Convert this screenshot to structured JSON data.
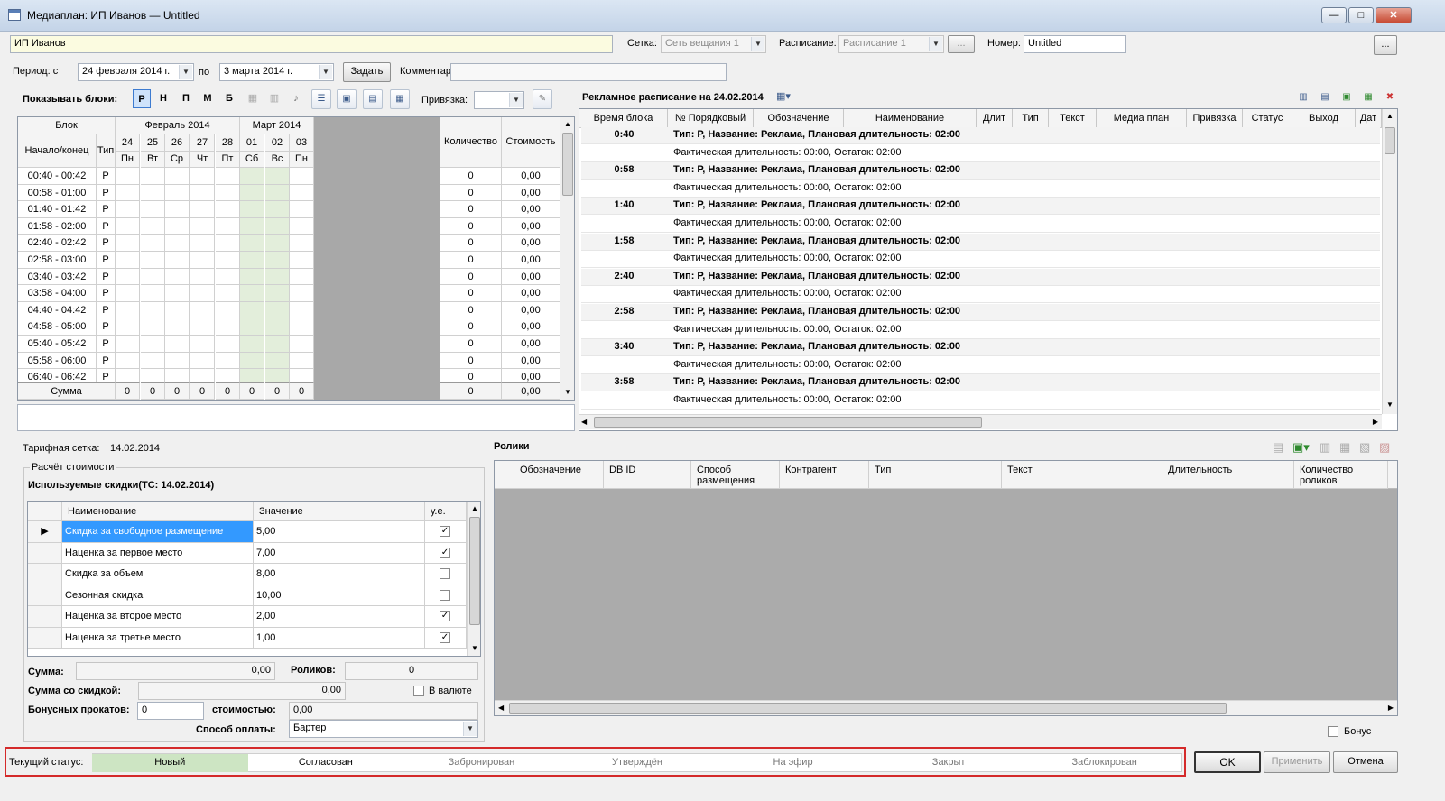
{
  "window": {
    "title": "Медиаплан: ИП Иванов — Untitled",
    "min": "—",
    "max": "□",
    "close": "✕"
  },
  "top": {
    "client": "ИП Иванов",
    "network_label": "Сетка:",
    "network_value": "Сеть вещания 1",
    "schedule_label": "Расписание:",
    "schedule_value": "Расписание 1",
    "ellipsis": "...",
    "number_label": "Номер:",
    "number_value": "Untitled",
    "period_label": "Период: с",
    "period_from": "24 февраля  2014 г.",
    "period_to_label": "по",
    "period_to": "3   марта   2014 г.",
    "set_button": "Задать",
    "comment_label": "Комментарий:",
    "comment_value": ""
  },
  "blocks_toolbar": {
    "label": "Показывать блоки:",
    "buttons": [
      "Р",
      "Н",
      "П",
      "М",
      "Б"
    ],
    "anchor_label": "Привязка:",
    "anchor_value": ""
  },
  "block_grid": {
    "col_block": "Блок",
    "col_startend": "Начало/конец",
    "col_type": "Тип",
    "month1": "Февраль 2014",
    "month2": "Март 2014",
    "days": [
      "24",
      "25",
      "26",
      "27",
      "28",
      "01",
      "02",
      "03"
    ],
    "weekdays": [
      "Пн",
      "Вт",
      "Ср",
      "Чт",
      "Пт",
      "Сб",
      "Вс",
      "Пн"
    ],
    "col_qty": "Количество",
    "col_cost": "Стоимость",
    "rows": [
      {
        "time": "00:40 - 00:42",
        "type": "Р",
        "qty": "0",
        "cost": "0,00"
      },
      {
        "time": "00:58 - 01:00",
        "type": "Р",
        "qty": "0",
        "cost": "0,00"
      },
      {
        "time": "01:40 - 01:42",
        "type": "Р",
        "qty": "0",
        "cost": "0,00"
      },
      {
        "time": "01:58 - 02:00",
        "type": "Р",
        "qty": "0",
        "cost": "0,00"
      },
      {
        "time": "02:40 - 02:42",
        "type": "Р",
        "qty": "0",
        "cost": "0,00"
      },
      {
        "time": "02:58 - 03:00",
        "type": "Р",
        "qty": "0",
        "cost": "0,00"
      },
      {
        "time": "03:40 - 03:42",
        "type": "Р",
        "qty": "0",
        "cost": "0,00"
      },
      {
        "time": "03:58 - 04:00",
        "type": "Р",
        "qty": "0",
        "cost": "0,00"
      },
      {
        "time": "04:40 - 04:42",
        "type": "Р",
        "qty": "0",
        "cost": "0,00"
      },
      {
        "time": "04:58 - 05:00",
        "type": "Р",
        "qty": "0",
        "cost": "0,00"
      },
      {
        "time": "05:40 - 05:42",
        "type": "Р",
        "qty": "0",
        "cost": "0,00"
      },
      {
        "time": "05:58 - 06:00",
        "type": "Р",
        "qty": "0",
        "cost": "0,00"
      },
      {
        "time": "06:40 - 06:42",
        "type": "Р",
        "qty": "0",
        "cost": "0,00"
      }
    ],
    "sum_label": "Сумма",
    "sum_days": [
      "0",
      "0",
      "0",
      "0",
      "0",
      "0",
      "0",
      "0"
    ],
    "sum_qty": "0",
    "sum_cost": "0,00"
  },
  "ad_schedule": {
    "title": "Рекламное расписание на 24.02.2014",
    "columns": [
      "Время блока",
      "№ Порядковый",
      "Обозначение",
      "Наименование",
      "Длит",
      "Тип",
      "Текст",
      "Медиа план",
      "Привязка",
      "Статус",
      "Выход",
      "Дат"
    ],
    "blocks": [
      {
        "time": "0:40",
        "info": "Тип: Р, Название: Реклама, Плановая длительность: 02:00",
        "fact": "Фактическая длительность: 00:00, Остаток: 02:00"
      },
      {
        "time": "0:58",
        "info": "Тип: Р, Название: Реклама, Плановая длительность: 02:00",
        "fact": "Фактическая длительность: 00:00, Остаток: 02:00"
      },
      {
        "time": "1:40",
        "info": "Тип: Р, Название: Реклама, Плановая длительность: 02:00",
        "fact": "Фактическая длительность: 00:00, Остаток: 02:00"
      },
      {
        "time": "1:58",
        "info": "Тип: Р, Название: Реклама, Плановая длительность: 02:00",
        "fact": "Фактическая длительность: 00:00, Остаток: 02:00"
      },
      {
        "time": "2:40",
        "info": "Тип: Р, Название: Реклама, Плановая длительность: 02:00",
        "fact": "Фактическая длительность: 00:00, Остаток: 02:00"
      },
      {
        "time": "2:58",
        "info": "Тип: Р, Название: Реклама, Плановая длительность: 02:00",
        "fact": "Фактическая длительность: 00:00, Остаток: 02:00"
      },
      {
        "time": "3:40",
        "info": "Тип: Р, Название: Реклама, Плановая длительность: 02:00",
        "fact": "Фактическая длительность: 00:00, Остаток: 02:00"
      },
      {
        "time": "3:58",
        "info": "Тип: Р, Название: Реклама, Плановая длительность: 02:00",
        "fact": "Фактическая длительность: 00:00, Остаток: 02:00"
      }
    ]
  },
  "tariff": {
    "label": "Тарифная сетка:",
    "value": "14.02.2014"
  },
  "cost_calc": {
    "group_label": "Расчёт стоимости",
    "discounts_title": "Используемые скидки(ТС: 14.02.2014)",
    "col_name": "Наименование",
    "col_value": "Значение",
    "col_ue": "у.е.",
    "rows": [
      {
        "name": "Скидка за свободное размещение",
        "value": "5,00",
        "checked": true
      },
      {
        "name": "Наценка за первое место",
        "value": "7,00",
        "checked": true
      },
      {
        "name": "Скидка за объем",
        "value": "8,00",
        "checked": false
      },
      {
        "name": "Сезонная скидка",
        "value": "10,00",
        "checked": false
      },
      {
        "name": "Наценка за второе место",
        "value": "2,00",
        "checked": true
      },
      {
        "name": "Наценка за третье место",
        "value": "1,00",
        "checked": true
      }
    ],
    "sum_label": "Сумма:",
    "sum_value": "0,00",
    "spots_label": "Роликов:",
    "spots_value": "0",
    "discounted_label": "Сумма со скидкой:",
    "discounted_value": "0,00",
    "currency_label": "В валюте",
    "bonus_label": "Бонусных прокатов:",
    "bonus_value": "0",
    "bonus_cost_label": "стоимостью:",
    "bonus_cost_value": "0,00",
    "payment_label": "Способ оплаты:",
    "payment_value": "Бартер"
  },
  "spots": {
    "title": "Ролики",
    "columns": [
      "Обозначение",
      "DB ID",
      "Способ размещения",
      "Контрагент",
      "Тип",
      "Текст",
      "Длительность",
      "Количество роликов"
    ],
    "bonus_label": "Бонус"
  },
  "status": {
    "label": "Текущий статус:",
    "items": [
      "Новый",
      "Согласован",
      "Забронирован",
      "Утверждён",
      "На эфир",
      "Закрыт",
      "Заблокирован"
    ],
    "active_color": "#cde5c3",
    "border_color": "#d42a2a"
  },
  "buttons": {
    "ok": "OK",
    "apply": "Применить",
    "cancel": "Отмена"
  }
}
